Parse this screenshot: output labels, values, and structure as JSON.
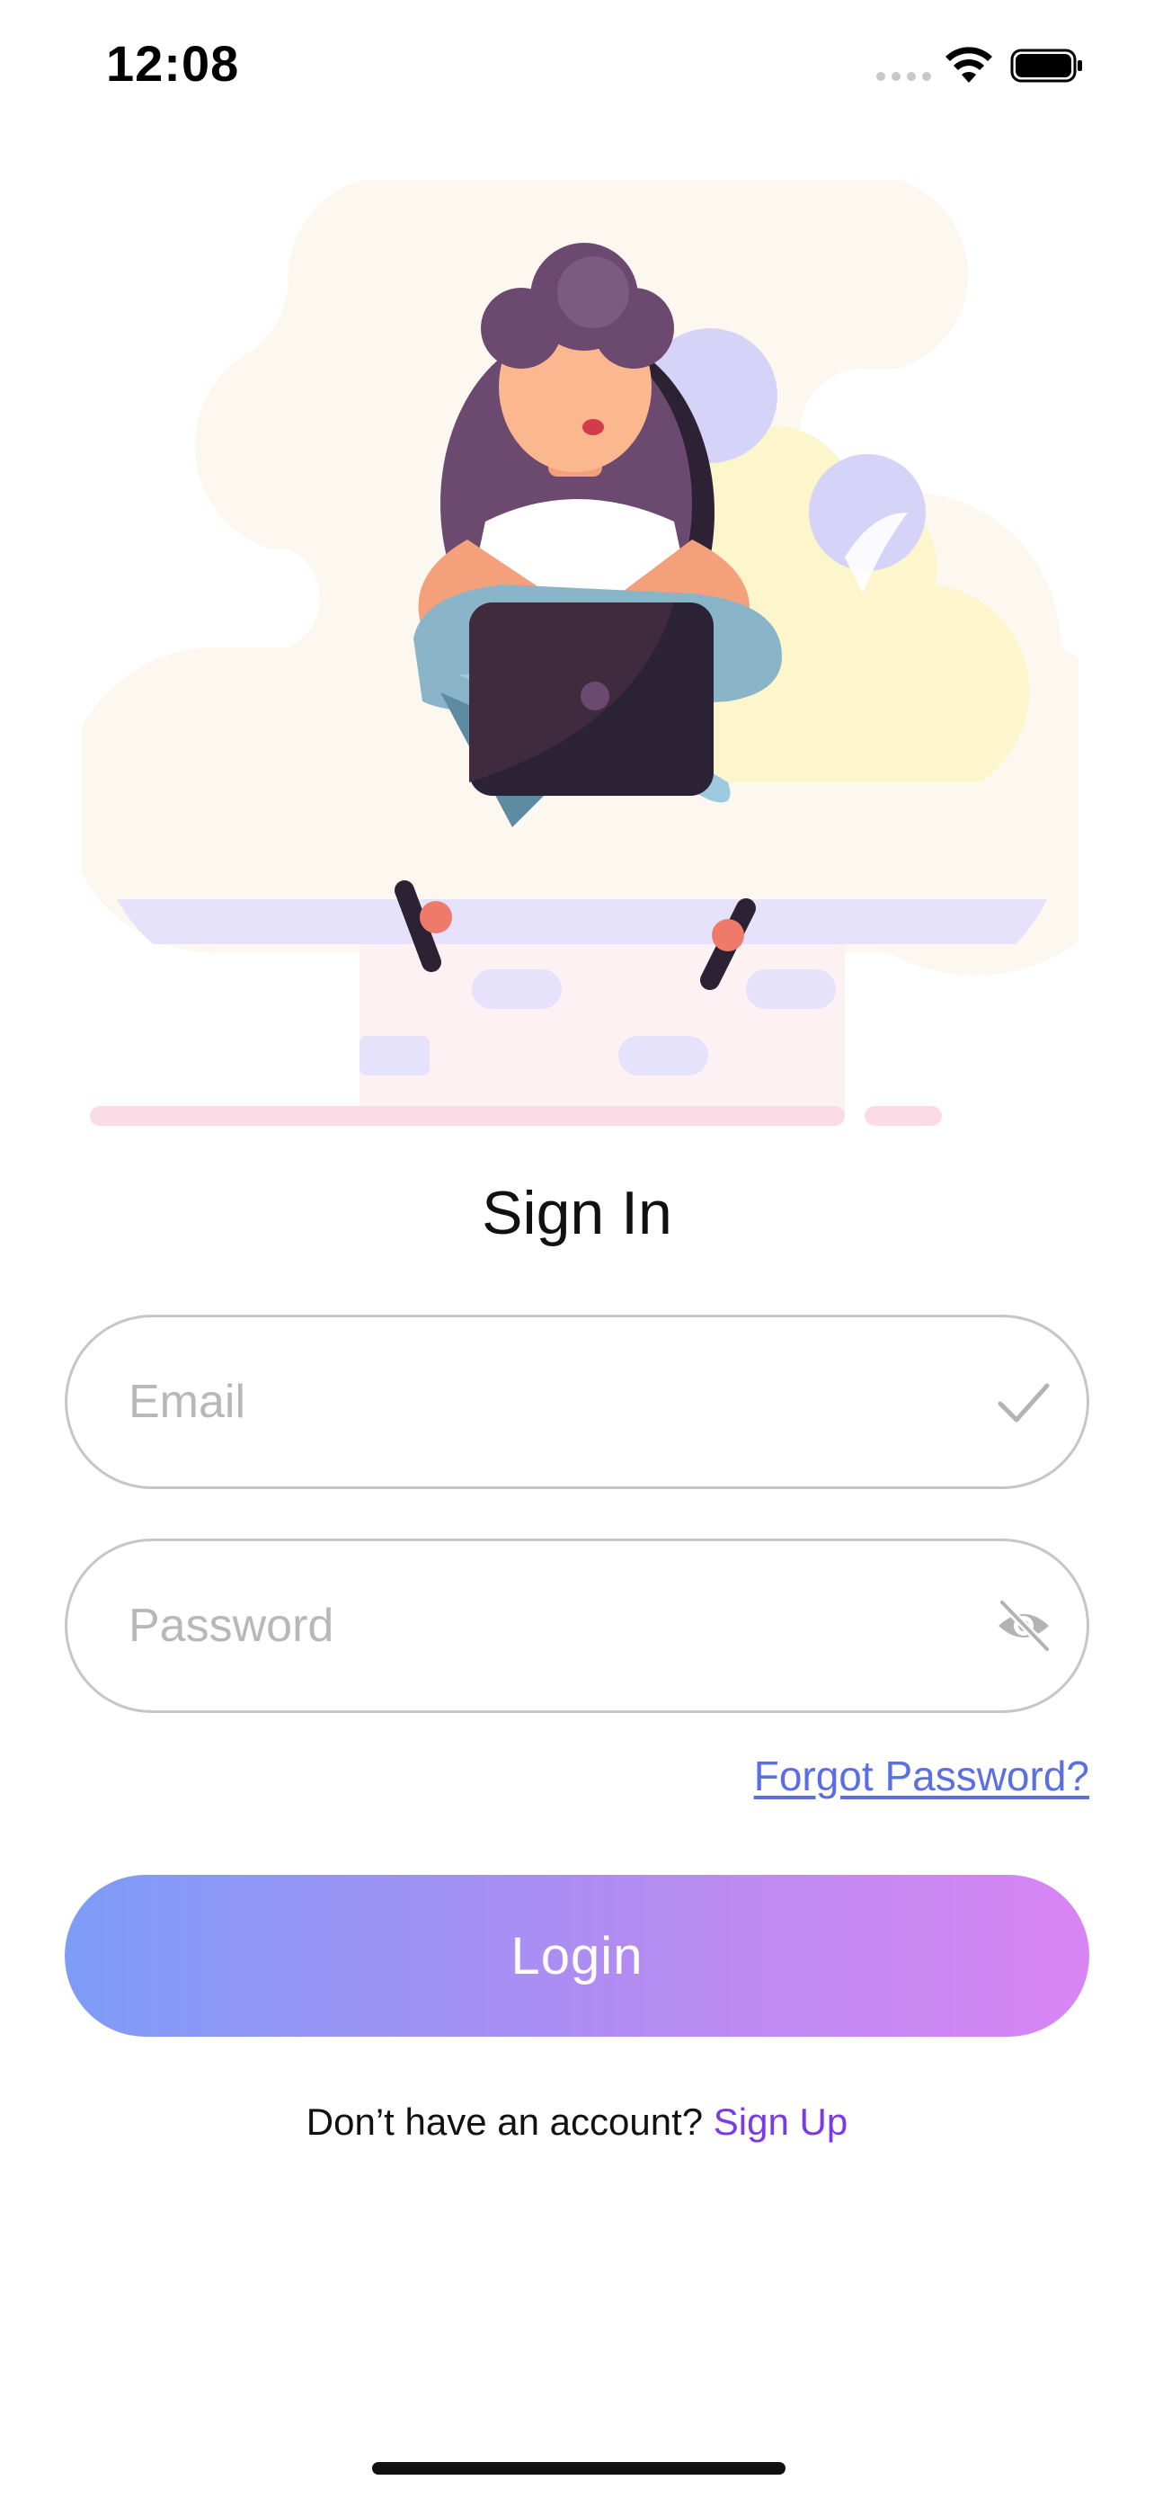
{
  "status_bar": {
    "time": "12:08"
  },
  "form": {
    "title": "Sign In",
    "email_placeholder": "Email",
    "password_placeholder": "Password",
    "forgot_password": "Forgot Password?",
    "login_label": "Login",
    "no_account_text": "Don’t have an account?",
    "signup_label": "Sign Up"
  },
  "colors": {
    "accent_link": "#5b6fe3",
    "signup_link": "#7b39e8",
    "button_gradient": [
      "#7d9cf7",
      "#d985f4"
    ]
  },
  "icons": {
    "email_valid": "checkmark-icon",
    "password_visibility": "eye-slash-icon"
  }
}
